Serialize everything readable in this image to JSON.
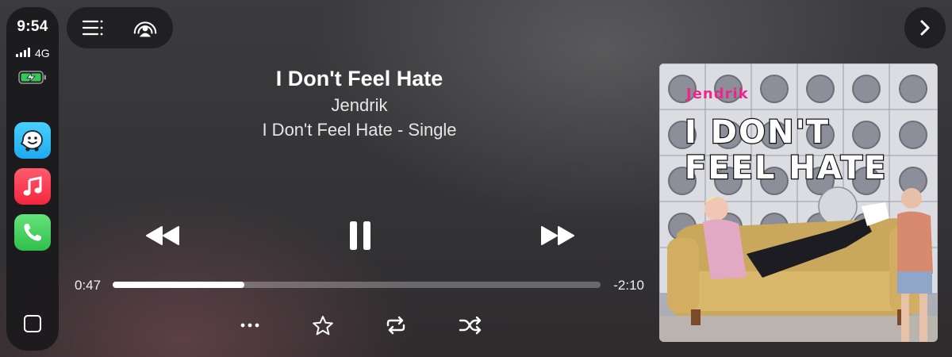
{
  "status": {
    "time": "9:54",
    "network": "4G",
    "signal_bars": 4,
    "battery_charging": true
  },
  "dock": {
    "apps": [
      {
        "name": "Waze"
      },
      {
        "name": "Music"
      },
      {
        "name": "Phone"
      }
    ]
  },
  "now_playing": {
    "title": "I Don't Feel Hate",
    "artist": "Jendrik",
    "album": "I Don't Feel Hate - Single",
    "elapsed": "0:47",
    "remaining": "-2:10",
    "progress_fraction": 0.27
  },
  "artwork": {
    "artist_text": "Jendrik",
    "title_line1": "I DON'T",
    "title_line2": "FEEL HATE"
  },
  "colors": {
    "artwork_pink": "#e8288a",
    "waze": "#33c3fb",
    "music": "#f53b52",
    "phone": "#3fcf5a"
  }
}
